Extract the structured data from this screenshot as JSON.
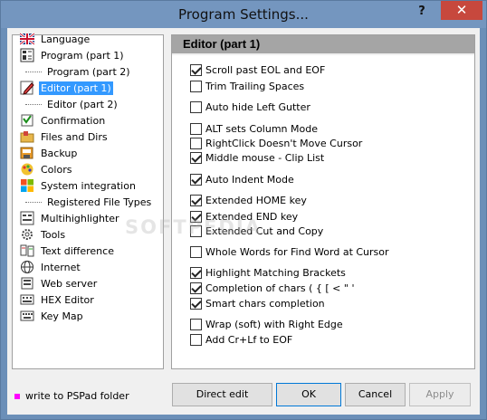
{
  "window": {
    "title": "Program Settings...",
    "help_label": "?",
    "close_label": "✕"
  },
  "tree": {
    "items": [
      {
        "label": "Language",
        "icon": "uk-flag-icon",
        "indent": 0,
        "selected": false
      },
      {
        "label": "Program  (part 1)",
        "icon": "program-icon",
        "indent": 0,
        "selected": false
      },
      {
        "label": "Program  (part 2)",
        "icon": "",
        "indent": 1,
        "selected": false
      },
      {
        "label": "Editor  (part 1)",
        "icon": "editor-pencil-icon",
        "indent": 0,
        "selected": true
      },
      {
        "label": "Editor  (part 2)",
        "icon": "",
        "indent": 1,
        "selected": false
      },
      {
        "label": "Confirmation",
        "icon": "confirmation-icon",
        "indent": 0,
        "selected": false
      },
      {
        "label": "Files and Dirs",
        "icon": "folder-icon",
        "indent": 0,
        "selected": false
      },
      {
        "label": "Backup",
        "icon": "backup-icon",
        "indent": 0,
        "selected": false
      },
      {
        "label": "Colors",
        "icon": "colors-icon",
        "indent": 0,
        "selected": false
      },
      {
        "label": "System integration",
        "icon": "windows-logo-icon",
        "indent": 0,
        "selected": false
      },
      {
        "label": "Registered File Types",
        "icon": "",
        "indent": 1,
        "selected": false
      },
      {
        "label": "Multihighlighter",
        "icon": "multihighlighter-icon",
        "indent": 0,
        "selected": false
      },
      {
        "label": "Tools",
        "icon": "gear-icon",
        "indent": 0,
        "selected": false
      },
      {
        "label": "Text difference",
        "icon": "text-difference-icon",
        "indent": 0,
        "selected": false
      },
      {
        "label": "Internet",
        "icon": "globe-icon",
        "indent": 0,
        "selected": false
      },
      {
        "label": "Web server",
        "icon": "web-server-icon",
        "indent": 0,
        "selected": false
      },
      {
        "label": "HEX Editor",
        "icon": "hex-editor-icon",
        "indent": 0,
        "selected": false
      },
      {
        "label": "Key Map",
        "icon": "keyboard-icon",
        "indent": 0,
        "selected": false
      }
    ]
  },
  "panel": {
    "title": "Editor  (part 1)",
    "options": [
      {
        "label": "Scroll past EOL and EOF",
        "checked": true
      },
      {
        "label": "Trim Trailing Spaces",
        "checked": false
      },
      {
        "label": "Auto hide Left Gutter",
        "checked": false
      },
      {
        "label": "ALT sets Column Mode",
        "checked": false
      },
      {
        "label": "RightClick Doesn't Move Cursor",
        "checked": false
      },
      {
        "label": "Middle mouse - Clip List",
        "checked": true
      },
      {
        "label": "Auto Indent Mode",
        "checked": true
      },
      {
        "label": "Extended HOME key",
        "checked": true
      },
      {
        "label": "Extended END key",
        "checked": true
      },
      {
        "label": "Extended Cut and Copy",
        "checked": false
      },
      {
        "label": "Whole Words for Find Word at Cursor",
        "checked": false
      },
      {
        "label": "Highlight Matching Brackets",
        "checked": true
      },
      {
        "label": "Completion of chars ( { [ < \" '",
        "checked": true
      },
      {
        "label": "Smart chars completion",
        "checked": true
      },
      {
        "label": "Wrap (soft) with Right Edge",
        "checked": false
      },
      {
        "label": "Add Cr+Lf to EOF",
        "checked": false
      }
    ]
  },
  "footer": {
    "note": "write to PSPad folder",
    "note_color": "#ff00ff",
    "direct_edit_label": "Direct edit",
    "ok_label": "OK",
    "cancel_label": "Cancel",
    "apply_label": "Apply"
  },
  "watermark": "SOFTPEDIA"
}
